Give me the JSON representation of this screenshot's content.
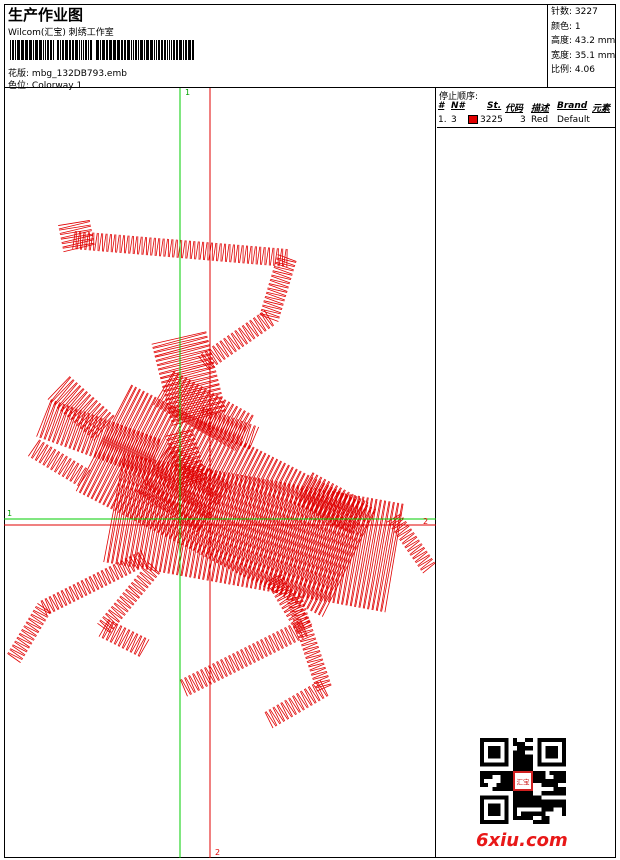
{
  "header": {
    "title": "生产作业图",
    "subtitle": "Wilcom(汇宝) 刺绣工作室",
    "design_label": "花版:",
    "design_name": "mbg_132DB793.emb",
    "colorway_label": "色位:",
    "colorway": "Colorway 1"
  },
  "stats": {
    "stitches": "针数: 3227",
    "colors": "颜色: 1",
    "height": "高度: 43.2 mm",
    "width": "宽度: 35.1 mm",
    "ratio": "比例: 4.06"
  },
  "stop_sequence": {
    "title": "停止顺序:",
    "headers": [
      "#",
      "N#",
      "St.",
      "代码",
      "描述",
      "Brand",
      "元素"
    ],
    "rows": [
      {
        "num": "1.",
        "needle": "3",
        "stitches": "3225",
        "code": "3",
        "description": "Red",
        "brand": "Default",
        "color": "#e00000"
      }
    ]
  },
  "axes": {
    "v1_top": "1",
    "v2_bottom": "2",
    "h1_left": "1",
    "h2_right": "2"
  },
  "colors": {
    "thread": "#e00000",
    "axis_green": "#00cc00",
    "axis_red": "#e00000"
  },
  "watermark": "6xiu.com",
  "qr_center_text": "汇宝"
}
